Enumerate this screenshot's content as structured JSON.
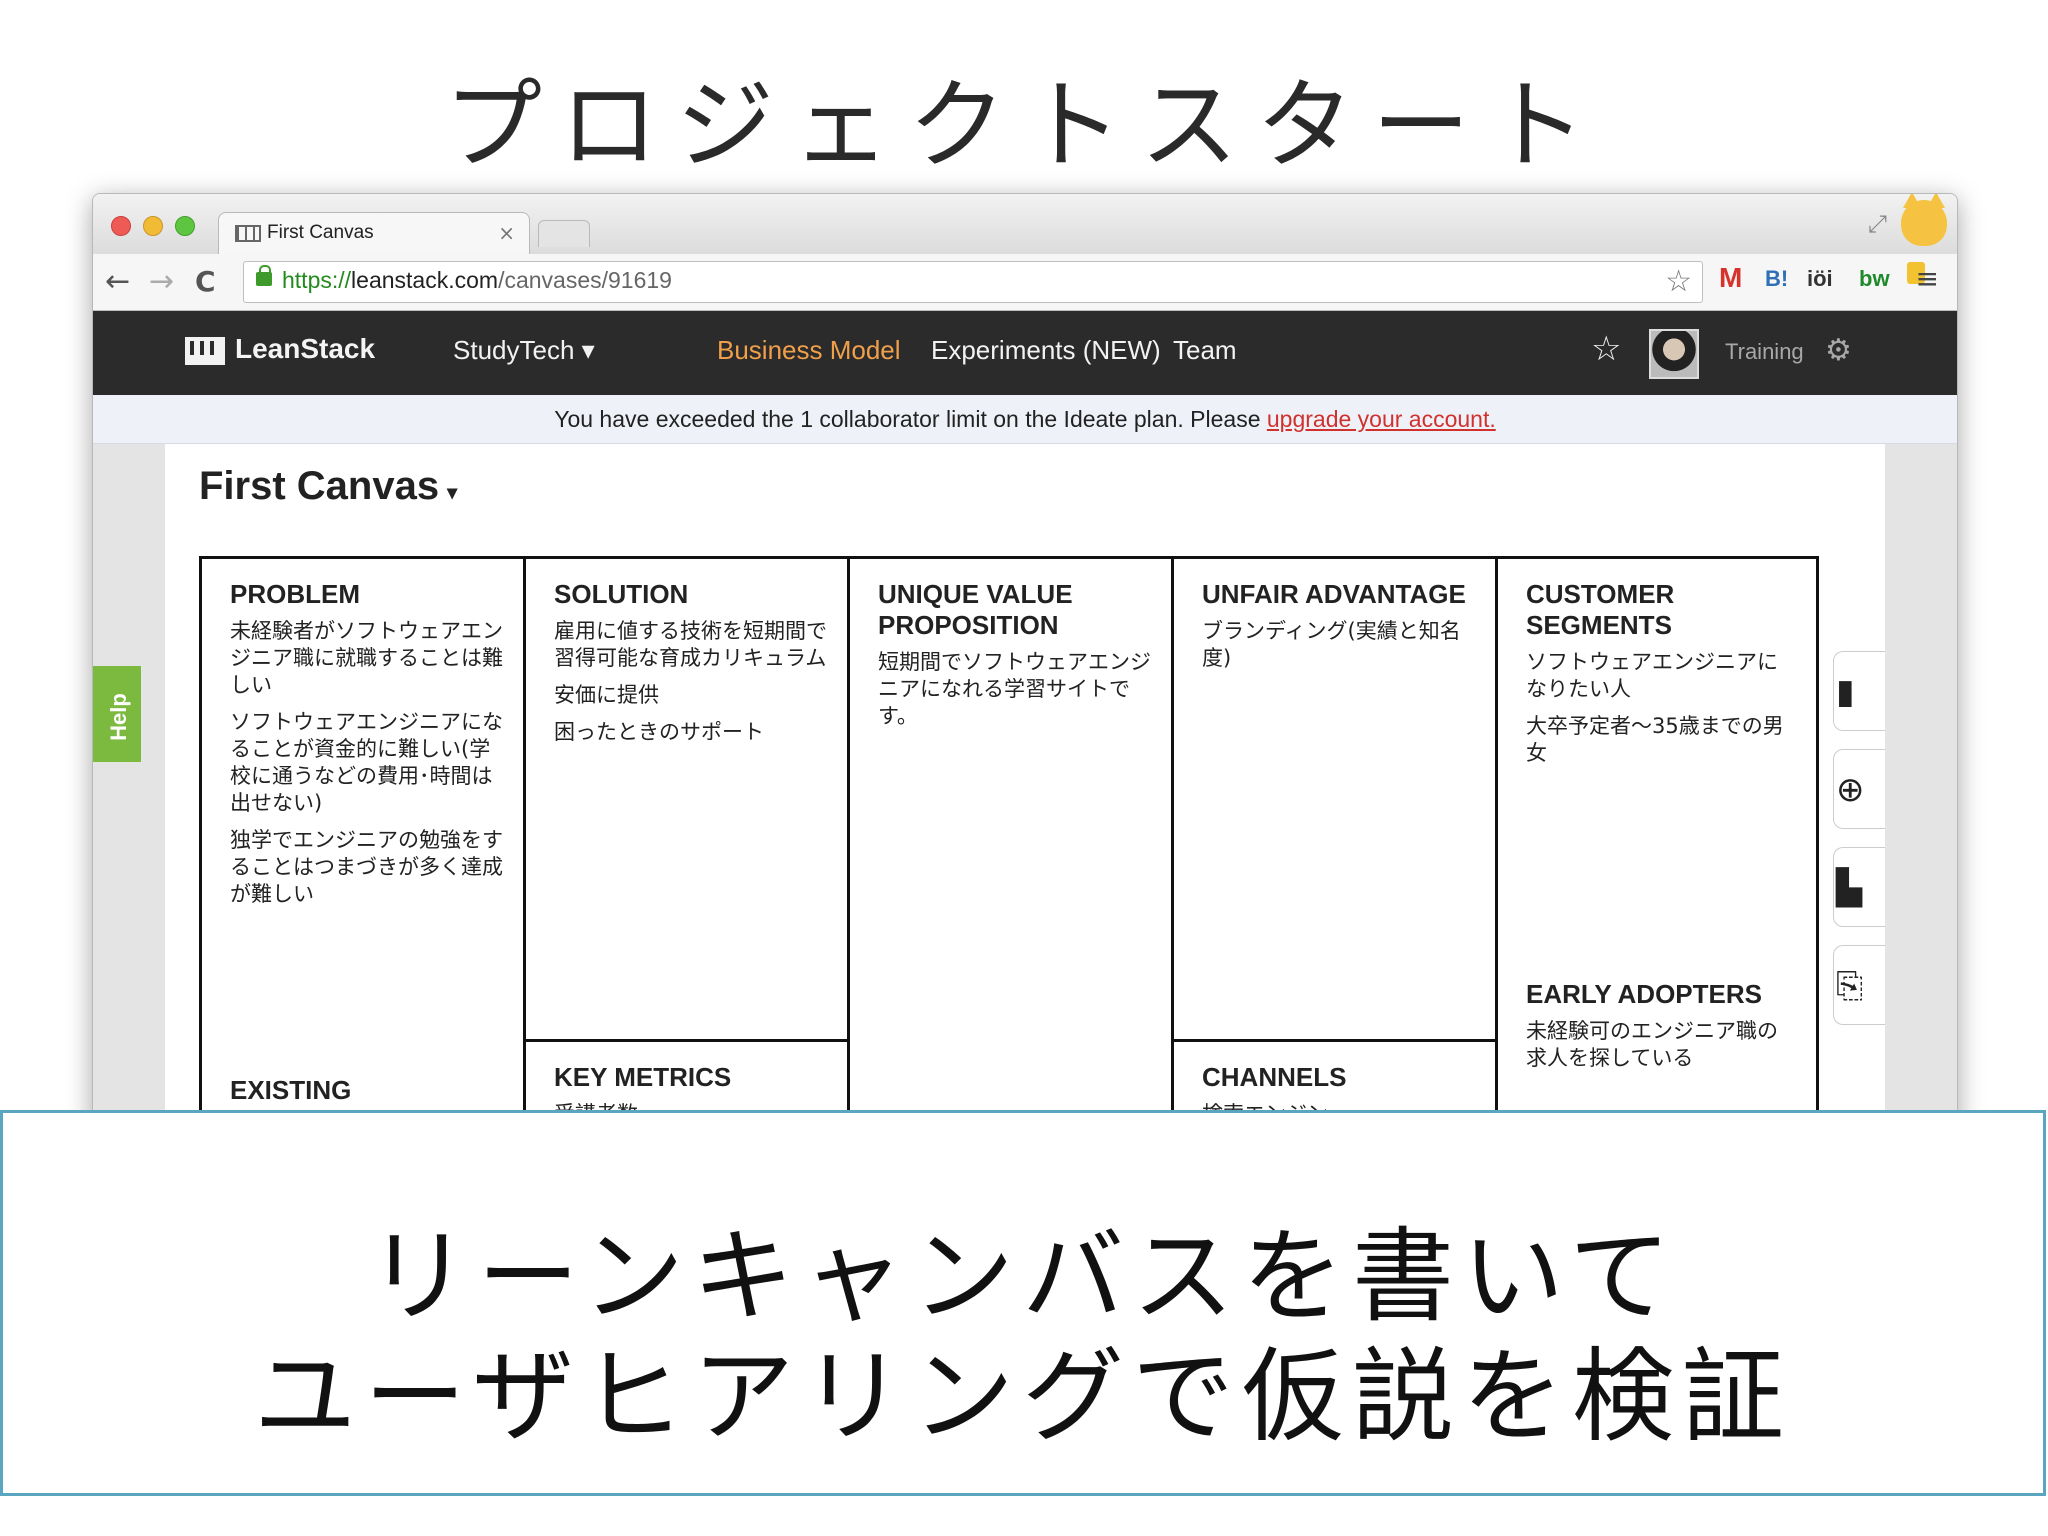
{
  "slide": {
    "title": "プロジェクトスタート",
    "caption_line1": "リーンキャンバスを書いて",
    "caption_line2": "ユーザヒアリングで仮説を検証"
  },
  "browser": {
    "tab_title": "First Canvas",
    "tab_close": "×",
    "url_scheme": "https://",
    "url_host": "leanstack.com",
    "url_path": "/canvases/91619",
    "back": "←",
    "forward": "→",
    "reload": "C",
    "bookmark_star": "☆",
    "menu": "≡",
    "extensions": [
      "M",
      "B!",
      "iöi",
      "bw"
    ]
  },
  "app": {
    "logo": "LeanStack",
    "project": "StudyTech ▾",
    "nav": [
      "Business Model",
      "Experiments (NEW)",
      "Team"
    ],
    "active_nav": "Business Model",
    "user_label": "Training",
    "accent": "#f0a04a"
  },
  "alert": {
    "text": "You have exceeded the 1 collaborator limit on the Ideate plan. Please ",
    "link": "upgrade your account."
  },
  "help": "Help",
  "canvas": {
    "title": "First Canvas",
    "caret": "▾",
    "problem": {
      "heading": "PROBLEM",
      "items": [
        "未経験者がソフトウェアエンジニア職に就職することは難しい",
        "ソフトウェアエンジニアになることが資金的に難しい(学校に通うなどの費用･時間は出せない)",
        "独学でエンジニアの勉強をすることはつまづきが多く達成が難しい"
      ],
      "sub_heading": "EXISTING"
    },
    "solution": {
      "heading": "SOLUTION",
      "items": [
        "雇用に値する技術を短期間で習得可能な育成カリキュラム",
        "安価に提供",
        "困ったときのサポート"
      ]
    },
    "key_metrics": {
      "heading": "KEY METRICS",
      "items": [
        "受講者数"
      ]
    },
    "uvp": {
      "heading": "UNIQUE VALUE PROPOSITION",
      "items": [
        "短期間でソフトウェアエンジニアになれる学習サイトです。"
      ]
    },
    "unfair": {
      "heading": "UNFAIR ADVANTAGE",
      "items": [
        "ブランディング(実績と知名度)"
      ]
    },
    "channels": {
      "heading": "CHANNELS",
      "items": [
        "検索エンジン"
      ]
    },
    "segments": {
      "heading": "CUSTOMER SEGMENTS",
      "items": [
        "ソフトウェアエンジニアになりたい人",
        "大卒予定者〜35歳までの男女"
      ]
    },
    "early": {
      "heading": "EARLY ADOPTERS",
      "items": [
        "未経験可のエンジニア職の求人を探している"
      ]
    }
  }
}
